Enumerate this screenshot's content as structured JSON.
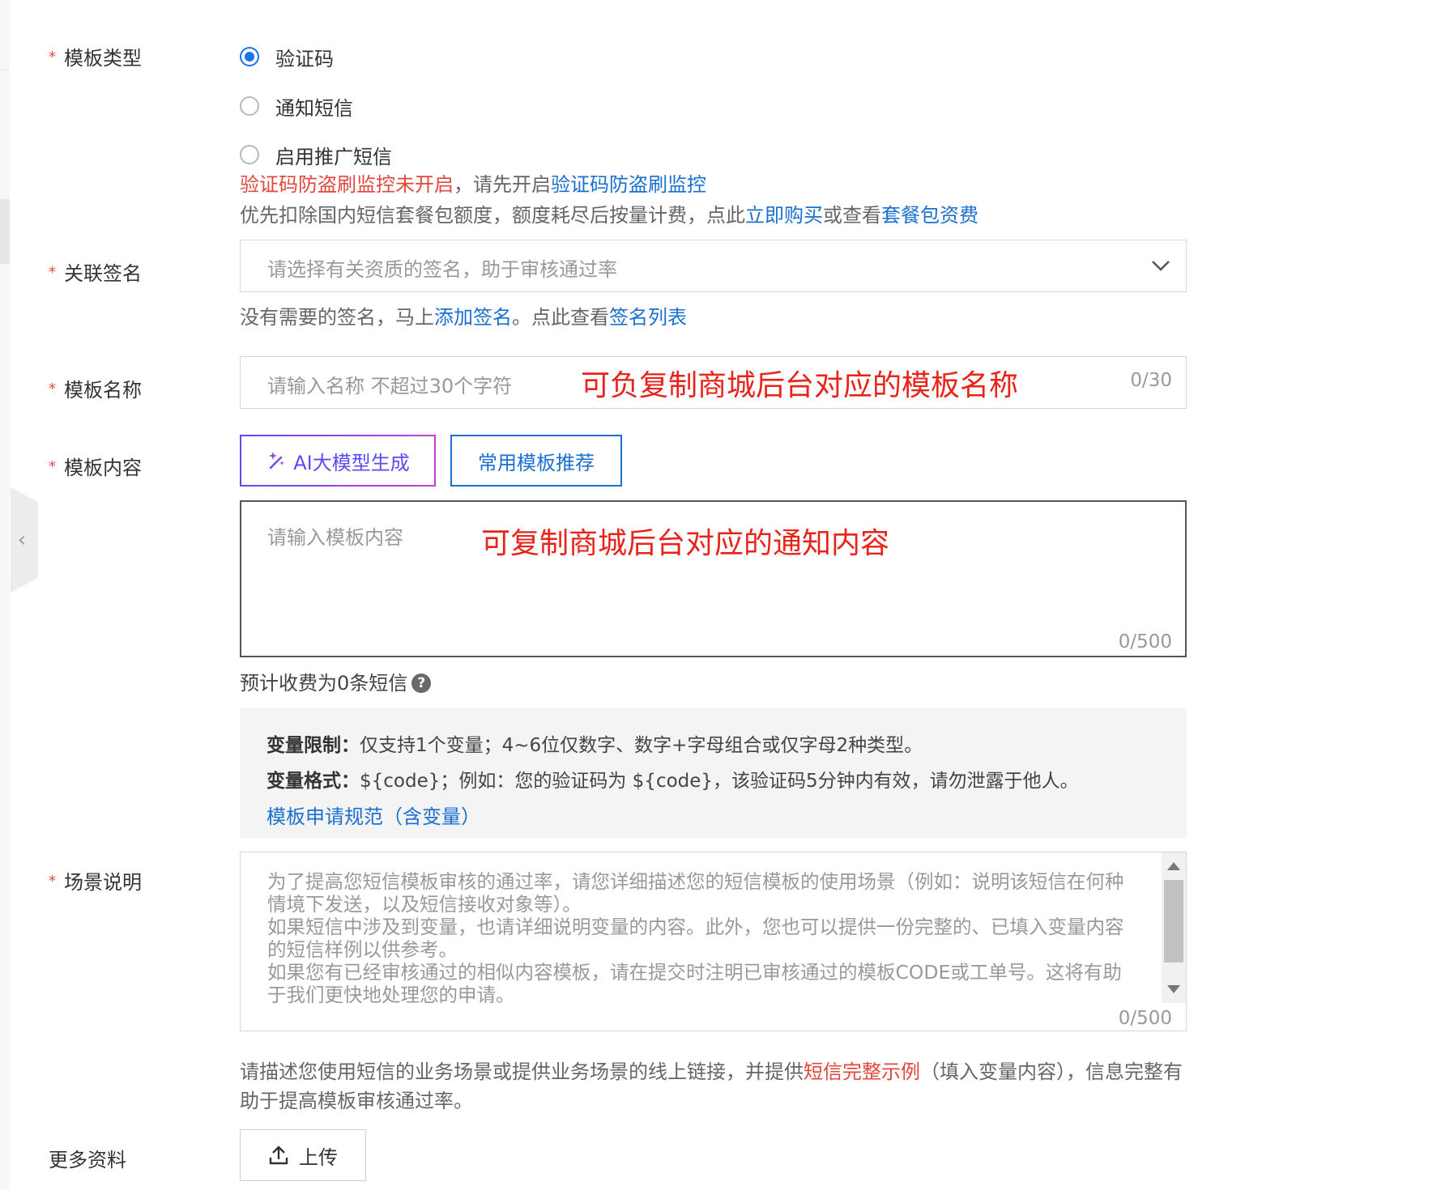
{
  "form": {
    "template_type": {
      "label": "模板类型",
      "options": [
        {
          "label": "验证码",
          "selected": true
        },
        {
          "label": "通知短信",
          "selected": false
        },
        {
          "label": "启用推广短信",
          "selected": false
        }
      ],
      "warning_red": "验证码防盗刷监控未开启",
      "warning_mid": "，请先开启",
      "warning_link": "验证码防盗刷监控",
      "billing_prefix": "优先扣除国内短信套餐包额度，额度耗尽后按量计费，点此",
      "billing_link1": "立即购买",
      "billing_mid": "或查看",
      "billing_link2": "套餐包资费"
    },
    "signature": {
      "label": "关联签名",
      "placeholder": "请选择有关资质的签名，助于审核通过率",
      "hint_prefix": "没有需要的签名，马上",
      "hint_link1": "添加签名",
      "hint_mid": "。点此查看",
      "hint_link2": "签名列表"
    },
    "template_name": {
      "label": "模板名称",
      "placeholder": "请输入名称 不超过30个字符",
      "counter": "0/30",
      "annotation": "可负复制商城后台对应的模板名称"
    },
    "template_content": {
      "label": "模板内容",
      "ai_button": "AI大模型生成",
      "recommend_button": "常用模板推荐",
      "placeholder": "请输入模板内容",
      "counter": "0/500",
      "annotation": "可复制商城后台对应的通知内容",
      "estimate": "预计收费为0条短信",
      "note_title1": "变量限制：",
      "note_text1": "仅支持1个变量；4~6位仅数字、数字+字母组合或仅字母2种类型。",
      "note_title2": "变量格式：",
      "note_text2": "${code}；例如：您的验证码为 ${code}，该验证码5分钟内有效，请勿泄露于他人。",
      "note_link": "模板申请规范（含变量）"
    },
    "scene": {
      "label": "场景说明",
      "placeholder": "为了提高您短信模板审核的通过率，请您详细描述您的短信模板的使用场景（例如：说明该短信在何种情境下发送，以及短信接收对象等）。\n如果短信中涉及到变量，也请详细说明变量的内容。此外，您也可以提供一份完整的、已填入变量内容的短信样例以供参考。\n如果您有已经审核通过的相似内容模板，请在提交时注明已审核通过的模板CODE或工单号。这将有助于我们更快地处理您的申请。",
      "counter": "0/500",
      "hint_prefix": "请描述您使用短信的业务场景或提供业务场景的线上链接，并提供",
      "hint_red": "短信完整示例",
      "hint_suffix": "（填入变量内容），信息完整有助于提高模板审核通过率。"
    },
    "more": {
      "label": "更多资料",
      "upload_button": "上传"
    }
  },
  "colors": {
    "primary": "#1a6fd1",
    "danger": "#e0483d",
    "ai_gradient_start": "#5a4cf5",
    "ai_gradient_end": "#c93bd8"
  },
  "icons": [
    "chevron-down-icon",
    "chevron-left-icon",
    "sparkle-icon",
    "help-icon",
    "upload-icon"
  ]
}
